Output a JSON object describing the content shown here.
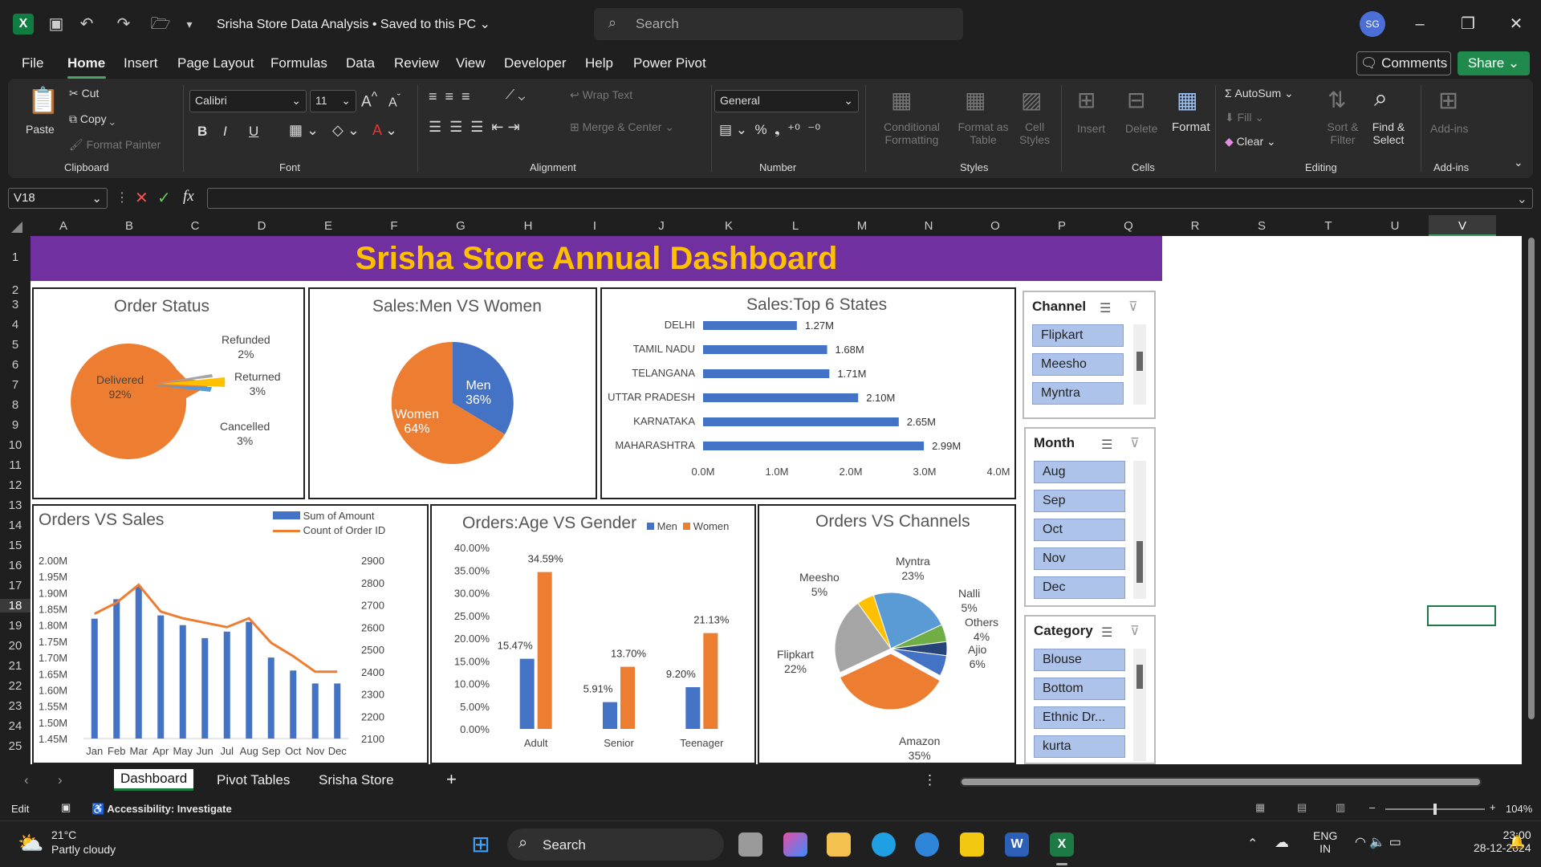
{
  "window": {
    "title": "Srisha Store Data Analysis • Saved to this PC",
    "search_placeholder": "Search",
    "avatar": "SG"
  },
  "menu": {
    "tabs": [
      "File",
      "Home",
      "Insert",
      "Page Layout",
      "Formulas",
      "Data",
      "Review",
      "View",
      "Developer",
      "Help",
      "Power Pivot"
    ],
    "comments": "Comments",
    "share": "Share"
  },
  "ribbon": {
    "clipboard": {
      "paste": "Paste",
      "cut": "Cut",
      "copy": "Copy",
      "format_painter": "Format Painter",
      "label": "Clipboard"
    },
    "font": {
      "name": "Calibri",
      "size": "11",
      "label": "Font",
      "bold": "B",
      "italic": "I",
      "underline": "U"
    },
    "alignment": {
      "wrap": "Wrap Text",
      "merge": "Merge & Center",
      "label": "Alignment"
    },
    "number": {
      "format": "General",
      "label": "Number"
    },
    "styles": {
      "conditional": "Conditional Formatting",
      "format_table": "Format as Table",
      "cell_styles": "Cell Styles",
      "label": "Styles"
    },
    "cells": {
      "insert": "Insert",
      "delete": "Delete",
      "format": "Format",
      "label": "Cells"
    },
    "editing": {
      "autosum": "AutoSum",
      "fill": "Fill",
      "clear": "Clear",
      "sort": "Sort & Filter",
      "find": "Find & Select",
      "label": "Editing"
    },
    "addins": {
      "addins": "Add-ins",
      "label": "Add-ins"
    }
  },
  "formula": {
    "namebox": "V18",
    "fx": "fx"
  },
  "columns": [
    "A",
    "B",
    "C",
    "D",
    "E",
    "F",
    "G",
    "H",
    "I",
    "J",
    "K",
    "L",
    "M",
    "N",
    "O",
    "P",
    "Q",
    "R",
    "S",
    "T",
    "U",
    "V"
  ],
  "rows": [
    "1",
    "2",
    "3",
    "4",
    "5",
    "6",
    "7",
    "8",
    "9",
    "10",
    "11",
    "12",
    "13",
    "14",
    "15",
    "16",
    "17",
    "18",
    "19",
    "20",
    "21",
    "22",
    "23",
    "24",
    "25"
  ],
  "dashboard": {
    "title": "Srisha Store Annual Dashboard"
  },
  "chart_data": [
    {
      "type": "pie",
      "title": "Order Status",
      "labels": [
        "Delivered",
        "Refunded",
        "Returned",
        "Cancelled"
      ],
      "values": [
        92,
        2,
        3,
        3
      ],
      "value_labels": [
        "92%",
        "2%",
        "3%",
        "3%"
      ],
      "colors": [
        "#ed7d31",
        "#a5a5a5",
        "#ffc000",
        "#5b9bd5"
      ]
    },
    {
      "type": "pie",
      "title": "Sales:Men VS Women",
      "labels": [
        "Men",
        "Women"
      ],
      "values": [
        36,
        64
      ],
      "value_labels": [
        "36%",
        "64%"
      ],
      "colors": [
        "#4472c4",
        "#ed7d31"
      ]
    },
    {
      "type": "bar",
      "title": "Sales:Top 6 States",
      "categories": [
        "DELHI",
        "TAMIL NADU",
        "TELANGANA",
        "UTTAR PRADESH",
        "KARNATAKA",
        "MAHARASHTRA"
      ],
      "values": [
        1.27,
        1.68,
        1.71,
        2.1,
        2.65,
        2.99
      ],
      "value_labels": [
        "1.27M",
        "1.68M",
        "1.71M",
        "2.10M",
        "2.65M",
        "2.99M"
      ],
      "xticks": [
        "0.0M",
        "1.0M",
        "2.0M",
        "3.0M",
        "4.0M"
      ],
      "xlim": [
        0,
        4
      ]
    },
    {
      "type": "bar",
      "title": "Orders VS Sales",
      "categories": [
        "Jan",
        "Feb",
        "Mar",
        "Apr",
        "May",
        "Jun",
        "Jul",
        "Aug",
        "Sep",
        "Oct",
        "Nov",
        "Dec"
      ],
      "series": [
        {
          "name": "Sum of Amount",
          "values": [
            1.82,
            1.88,
            1.92,
            1.83,
            1.8,
            1.76,
            1.78,
            1.81,
            1.7,
            1.66,
            1.62,
            1.62
          ]
        },
        {
          "name": "Count of Order ID",
          "values": [
            2660,
            2710,
            2790,
            2670,
            2640,
            2620,
            2600,
            2640,
            2530,
            2470,
            2400,
            2400
          ]
        }
      ],
      "yticks_left": [
        "2.00M",
        "1.95M",
        "1.90M",
        "1.85M",
        "1.80M",
        "1.75M",
        "1.70M",
        "1.65M",
        "1.60M",
        "1.55M",
        "1.50M",
        "1.45M"
      ],
      "ylim_left": [
        1.45,
        2.0
      ],
      "yticks_right": [
        "2900",
        "2800",
        "2700",
        "2600",
        "2500",
        "2400",
        "2300",
        "2200",
        "2100"
      ],
      "ylim_right": [
        2100,
        2900
      ]
    },
    {
      "type": "bar",
      "title": "Orders:Age VS Gender",
      "categories": [
        "Adult",
        "Senior",
        "Teenager"
      ],
      "series": [
        {
          "name": "Men",
          "values": [
            15.47,
            5.91,
            9.2
          ],
          "labels": [
            "15.47%",
            "5.91%",
            "9.20%"
          ]
        },
        {
          "name": "Women",
          "values": [
            34.59,
            13.7,
            21.13
          ],
          "labels": [
            "34.59%",
            "13.70%",
            "21.13%"
          ]
        }
      ],
      "yticks": [
        "40.00%",
        "35.00%",
        "30.00%",
        "25.00%",
        "20.00%",
        "15.00%",
        "10.00%",
        "5.00%",
        "0.00%"
      ],
      "ylim": [
        0,
        40
      ]
    },
    {
      "type": "pie",
      "title": "Orders VS Channels",
      "labels": [
        "Amazon",
        "Flipkart",
        "Meesho",
        "Myntra",
        "Nalli",
        "Others",
        "Ajio"
      ],
      "values": [
        35,
        22,
        5,
        23,
        5,
        4,
        6
      ],
      "value_labels": [
        "35%",
        "22%",
        "5%",
        "23%",
        "5%",
        "4%",
        "6%"
      ],
      "colors": [
        "#ed7d31",
        "#a5a5a5",
        "#ffc000",
        "#5b9bd5",
        "#70ad47",
        "#264478",
        "#4472c4"
      ]
    }
  ],
  "slicers": [
    {
      "title": "Channel",
      "items": [
        "Flipkart",
        "Meesho",
        "Myntra"
      ]
    },
    {
      "title": "Month",
      "items": [
        "Aug",
        "Sep",
        "Oct",
        "Nov",
        "Dec"
      ]
    },
    {
      "title": "Category",
      "items": [
        "Blouse",
        "Bottom",
        "Ethnic Dr...",
        "kurta"
      ]
    }
  ],
  "sheets": {
    "tabs": [
      "Dashboard",
      "Pivot Tables",
      "Srisha Store"
    ],
    "active": "Dashboard"
  },
  "status": {
    "mode": "Edit",
    "accessibility": "Accessibility: Investigate",
    "zoom": "104%"
  },
  "taskbar": {
    "temp": "21°C",
    "weather": "Partly cloudy",
    "search": "Search",
    "lang1": "ENG",
    "lang2": "IN",
    "time": "23:00",
    "date": "28-12-2024"
  }
}
